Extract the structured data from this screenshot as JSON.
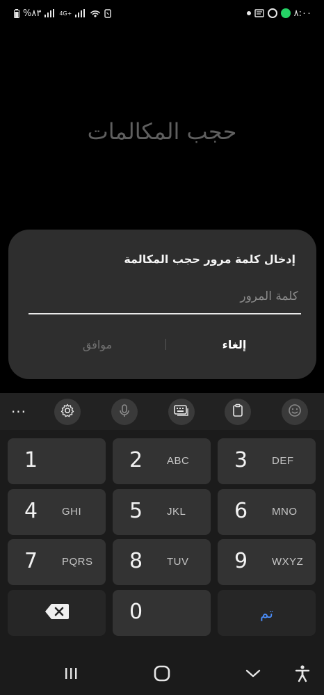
{
  "status_bar": {
    "battery": "%٨٣",
    "network": "4G+",
    "time": "٨:٠٠"
  },
  "screen": {
    "title": "حجب المكالمات"
  },
  "dialog": {
    "title": "إدخال كلمة مرور حجب المكالمة",
    "input_placeholder": "كلمة المرور",
    "input_value": "",
    "cancel_label": "إلغاء",
    "ok_label": "موافق"
  },
  "keyboard": {
    "toolbar": {
      "more_label": "···",
      "icons": [
        "settings-icon",
        "microphone-icon",
        "keyboard-icon",
        "clipboard-icon",
        "emoji-icon"
      ]
    },
    "keys": [
      {
        "num": "1",
        "letters": ""
      },
      {
        "num": "2",
        "letters": "ABC"
      },
      {
        "num": "3",
        "letters": "DEF"
      },
      {
        "num": "4",
        "letters": "GHI"
      },
      {
        "num": "5",
        "letters": "JKL"
      },
      {
        "num": "6",
        "letters": "MNO"
      },
      {
        "num": "7",
        "letters": "PQRS"
      },
      {
        "num": "8",
        "letters": "TUV"
      },
      {
        "num": "9",
        "letters": "WXYZ"
      },
      {
        "num": "0",
        "letters": ""
      }
    ],
    "done_label": "تم"
  },
  "colors": {
    "accent": "#4a8cf7",
    "whatsapp": "#25D366",
    "dialog_bg": "#2e2e2e",
    "key_bg": "#333333"
  }
}
